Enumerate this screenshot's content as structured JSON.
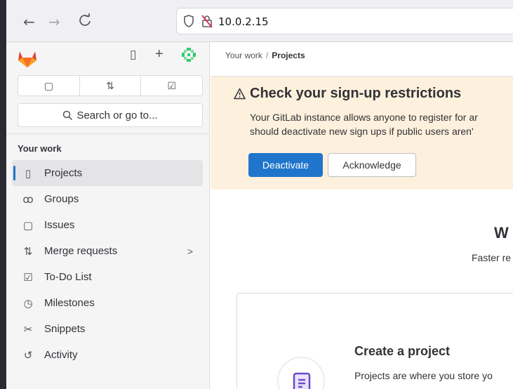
{
  "browser": {
    "back_icon": "←",
    "forward_icon": "→",
    "reload_icon": "C",
    "url": "10.0.2.15"
  },
  "sidebar": {
    "top_icons": {
      "panel_icon": "▯",
      "new_icon": "+"
    },
    "shortcuts": [
      {
        "name": "issues-icon",
        "glyph": "▢"
      },
      {
        "name": "merge-requests-icon",
        "glyph": "⇅"
      },
      {
        "name": "todo-icon",
        "glyph": "☑"
      }
    ],
    "search_label": "Search or go to...",
    "section_title": "Your work",
    "items": [
      {
        "label": "Projects",
        "icon": "▯"
      },
      {
        "label": "Groups",
        "icon": "ꝏ"
      },
      {
        "label": "Issues",
        "icon": "▢"
      },
      {
        "label": "Merge requests",
        "icon": "⇅",
        "chevron": ">"
      },
      {
        "label": "To-Do List",
        "icon": "☑"
      },
      {
        "label": "Milestones",
        "icon": "◷"
      },
      {
        "label": "Snippets",
        "icon": "✂"
      },
      {
        "label": "Activity",
        "icon": "↺"
      }
    ]
  },
  "main": {
    "breadcrumb": {
      "parent": "Your work",
      "separator": "/",
      "current": "Projects"
    },
    "alert": {
      "title": "Check your sign-up restrictions",
      "line1": "Your GitLab instance allows anyone to register for ar",
      "line2": "should deactivate new sign ups if public users aren'",
      "primary_button": "Deactivate",
      "secondary_button": "Acknowledge"
    },
    "welcome_title": "W",
    "welcome_subtitle": "Faster re",
    "card": {
      "title": "Create a project",
      "text": "Projects are where you store yo"
    }
  },
  "colors": {
    "primary": "#1f75cb",
    "alert_bg": "#fdf1dd",
    "logo": "#e24329"
  }
}
